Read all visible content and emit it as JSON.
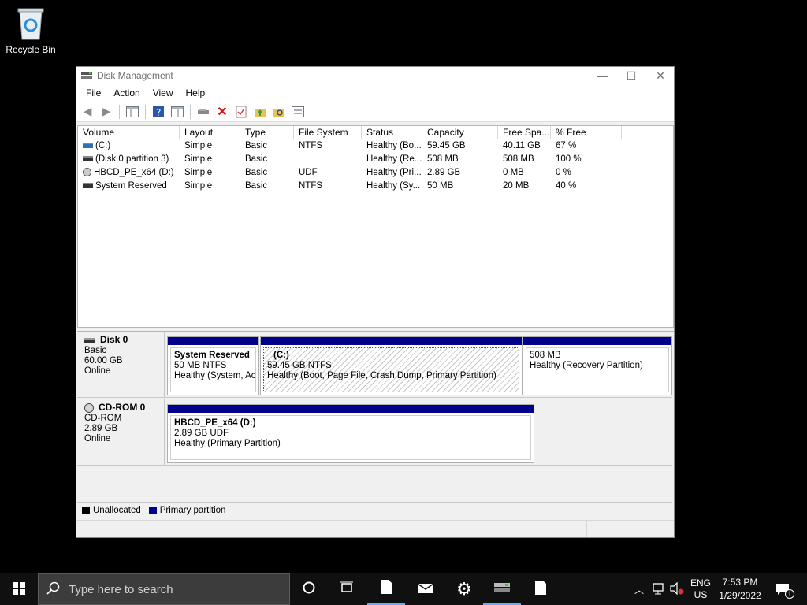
{
  "desktop": {
    "recycle_bin_label": "Recycle Bin"
  },
  "window": {
    "title": "Disk Management",
    "controls": {
      "minimize": "—",
      "maximize": "☐",
      "close": "✕"
    }
  },
  "menu": {
    "items": [
      "File",
      "Action",
      "View",
      "Help"
    ]
  },
  "volume_list": {
    "columns": [
      "Volume",
      "Layout",
      "Type",
      "File System",
      "Status",
      "Capacity",
      "Free Spa...",
      "% Free"
    ],
    "rows": [
      {
        "volume": "(C:)",
        "layout": "Simple",
        "type": "Basic",
        "fs": "NTFS",
        "status": "Healthy (Bo...",
        "capacity": "59.45 GB",
        "free": "40.11 GB",
        "pct": "67 %"
      },
      {
        "volume": "(Disk 0 partition 3)",
        "layout": "Simple",
        "type": "Basic",
        "fs": "",
        "status": "Healthy (Re...",
        "capacity": "508 MB",
        "free": "508 MB",
        "pct": "100 %"
      },
      {
        "volume": "HBCD_PE_x64 (D:)",
        "layout": "Simple",
        "type": "Basic",
        "fs": "UDF",
        "status": "Healthy (Pri...",
        "capacity": "2.89 GB",
        "free": "0 MB",
        "pct": "0 %"
      },
      {
        "volume": "System Reserved",
        "layout": "Simple",
        "type": "Basic",
        "fs": "NTFS",
        "status": "Healthy (Sy...",
        "capacity": "50 MB",
        "free": "20 MB",
        "pct": "40 %"
      }
    ]
  },
  "disks": [
    {
      "name": "Disk 0",
      "kind": "Basic",
      "size": "60.00 GB",
      "state": "Online",
      "partitions": [
        {
          "name": "System Reserved",
          "size": "50 MB NTFS",
          "status": "Healthy (System, Activ"
        },
        {
          "name": "(C:)",
          "size": "59.45 GB NTFS",
          "status": "Healthy (Boot, Page File, Crash Dump, Primary Partition)"
        },
        {
          "name": "",
          "size": "508 MB",
          "status": "Healthy (Recovery Partition)"
        }
      ]
    },
    {
      "name": "CD-ROM 0",
      "kind": "CD-ROM",
      "size": "2.89 GB",
      "state": "Online",
      "partitions": [
        {
          "name": "HBCD_PE_x64  (D:)",
          "size": "2.89 GB UDF",
          "status": "Healthy (Primary Partition)"
        }
      ]
    }
  ],
  "legend": {
    "unallocated": "Unallocated",
    "primary": "Primary partition",
    "unallocated_color": "#000000",
    "primary_color": "#00008b"
  },
  "taskbar": {
    "search_placeholder": "Type here to search",
    "lang_top": "ENG",
    "lang_bottom": "US",
    "time": "7:53 PM",
    "date": "1/29/2022",
    "notification_count": "1"
  }
}
